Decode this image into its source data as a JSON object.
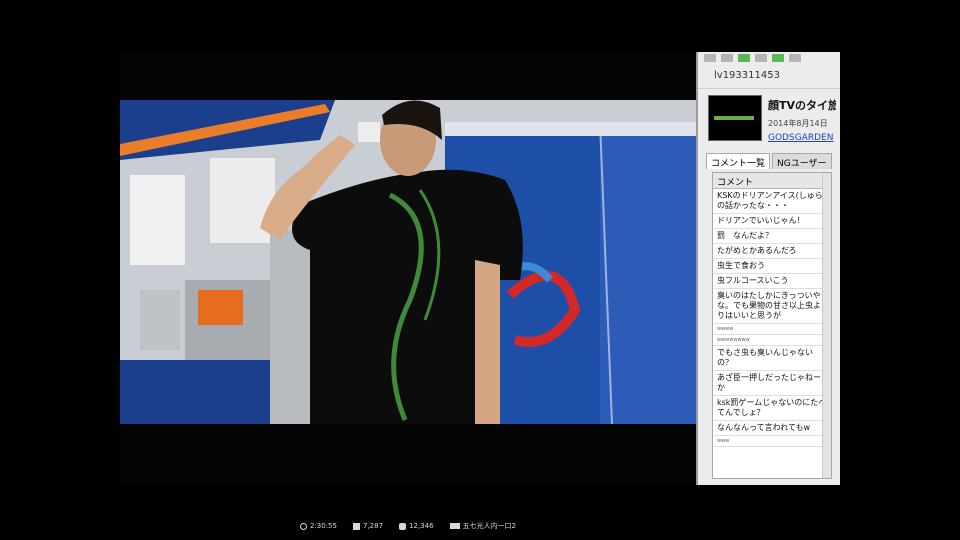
{
  "status_bar": {
    "time": "2:30:55",
    "viewers": "7,287",
    "comments": "12,346",
    "community": "五七光人内一口2"
  },
  "side_panel": {
    "live_id": "lv193311453",
    "title": "顔TVのタイ旅",
    "date": "2014年8月14日",
    "community_link": "GODSGARDEN",
    "tabs": [
      "コメント一覧",
      "NGユーザー"
    ],
    "comment_header": "コメント",
    "comments": [
      "KSKのドリアンアイス(しゅら)の話かったな・・・",
      "ドリアンでいいじゃん！",
      "罰　なんだよ？",
      "たがめとかあるんだろ",
      "虫生で食おう",
      "虫フルコースいこう",
      "臭いのはたしかにきっついやな。でも果物の甘さ以上虫よりはいいと思うが",
      "wwww",
      "wwwwwwww",
      "でもさ虫も臭いんじゃないの？",
      "あざ臣一押しだったじゃねーか",
      "ksk罰ゲームじゃないのにたべてんでしょ？",
      "なんなんって言われてもw",
      "www"
    ]
  },
  "colors": {
    "accent_green": "#57b957",
    "link_blue": "#1f45c8",
    "panel_bg": "#ececec"
  }
}
